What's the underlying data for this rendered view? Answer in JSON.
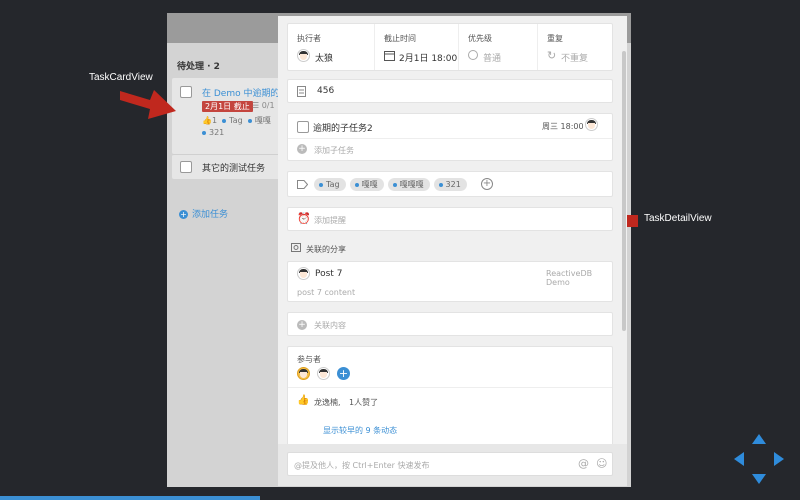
{
  "board": {
    "stage_title": "待处理 · 2",
    "task_card": {
      "title": "在 Demo 中逾期的任务",
      "due_badge": "2月1日 截止",
      "subtask_count": "0/1",
      "like_count": "1",
      "tags": [
        "Tag",
        "嘎嘎"
      ],
      "tag2": "321"
    },
    "task_card_2": {
      "title": "其它的测试任务"
    },
    "add_task_label": "添加任务"
  },
  "annotations": {
    "left_label": "TaskCardView",
    "right_label": "TaskDetailView"
  },
  "detail": {
    "meta": {
      "executor_label": "执行者",
      "executor_value": "太狼",
      "due_label": "截止时间",
      "due_value": "2月1日 18:00",
      "priority_label": "优先级",
      "priority_value": "普通",
      "repeat_label": "重复",
      "repeat_value": "不重复"
    },
    "note_value": "456",
    "subtask": {
      "title": "逾期的子任务2",
      "time": "周三 18:00",
      "add_label": "添加子任务"
    },
    "tags": [
      "Tag",
      "嘎嘎",
      "嘎嘎嘎",
      "321"
    ],
    "reminder_placeholder": "添加提醒",
    "share_section_label": "关联的分享",
    "post": {
      "title": "Post 7",
      "source": "ReactiveDB Demo",
      "content": "post 7 content"
    },
    "link_content_label": "关联内容",
    "participants_label": "参与者",
    "activity": {
      "like_user": "龙逸楠,",
      "like_text": "1人赞了",
      "show_more": "显示较早的 9 条动态"
    },
    "comment_placeholder": "@提及他人，按 Ctrl+Enter 快速发布"
  },
  "colors": {
    "accent": "#3b8fd4",
    "overdue": "#c4453e",
    "arrow": "#c0281e",
    "background": "#25272c"
  }
}
